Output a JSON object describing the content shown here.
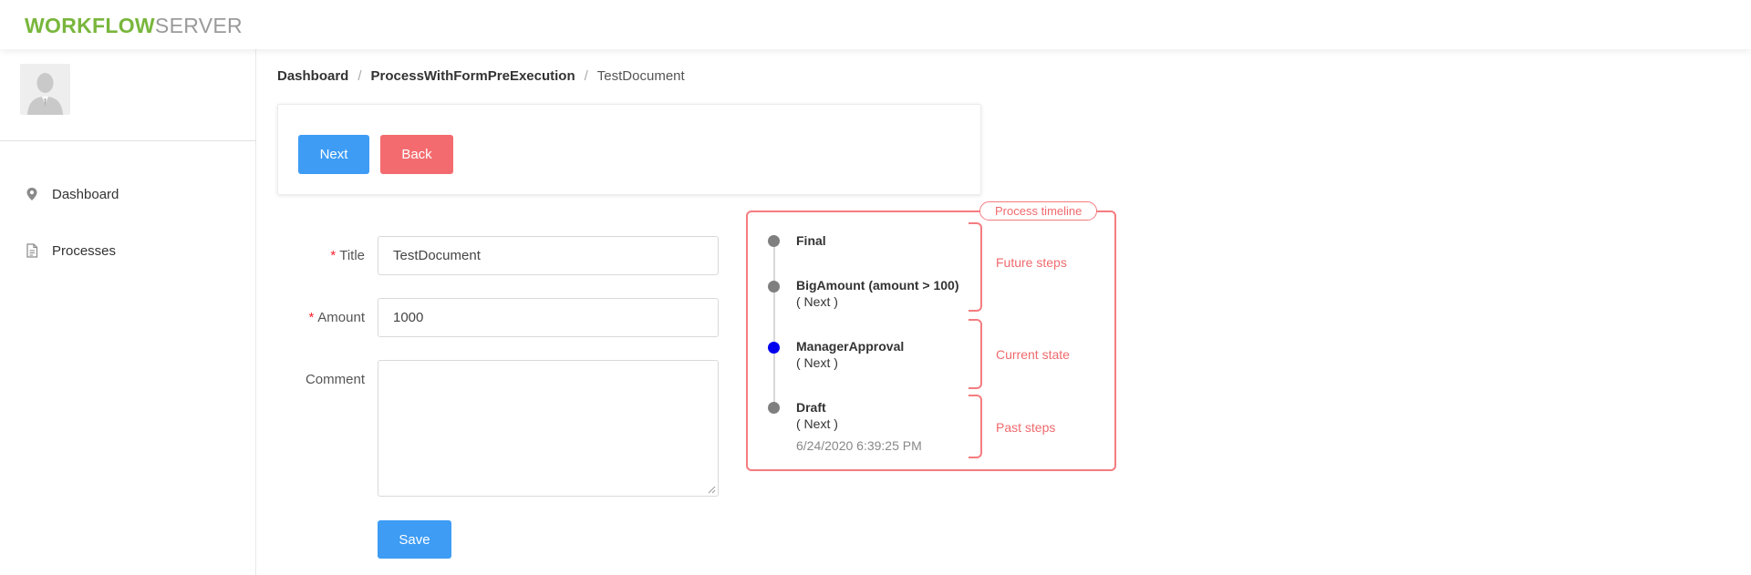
{
  "app": {
    "logo_part1": "WORKFLOW",
    "logo_part2": "SERVER",
    "brand_green": "#79b63c"
  },
  "sidebar": {
    "items": [
      {
        "label": "Dashboard",
        "icon": "map-pin-icon"
      },
      {
        "label": "Processes",
        "icon": "document-icon"
      }
    ]
  },
  "breadcrumb": {
    "items": [
      "Dashboard",
      "ProcessWithFormPreExecution",
      "TestDocument"
    ]
  },
  "actions": {
    "next_label": "Next",
    "back_label": "Back"
  },
  "form": {
    "title": {
      "label": "Title",
      "required": true,
      "value": "TestDocument"
    },
    "amount": {
      "label": "Amount",
      "required": true,
      "value": "1000"
    },
    "comment": {
      "label": "Comment",
      "required": false,
      "value": ""
    },
    "save_label": "Save",
    "required_marker": "*"
  },
  "timeline": {
    "tag": "Process timeline",
    "steps": [
      {
        "title": "Final",
        "sub": "",
        "date": "",
        "state": "future"
      },
      {
        "title": "BigAmount (amount > 100)",
        "sub": "( Next )",
        "date": "",
        "state": "future"
      },
      {
        "title": "ManagerApproval",
        "sub": "( Next )",
        "date": "",
        "state": "current"
      },
      {
        "title": "Draft",
        "sub": "( Next )",
        "date": "6/24/2020 6:39:25 PM",
        "state": "past"
      }
    ],
    "groups": {
      "future": "Future steps",
      "current": "Current state",
      "past": "Past steps"
    },
    "colors": {
      "accent": "#f47c80",
      "current_dot": "#0000ee",
      "dot": "#7f7f7f"
    }
  },
  "colors": {
    "primary_button": "#3e9cf5",
    "danger_button": "#f36b6f"
  }
}
